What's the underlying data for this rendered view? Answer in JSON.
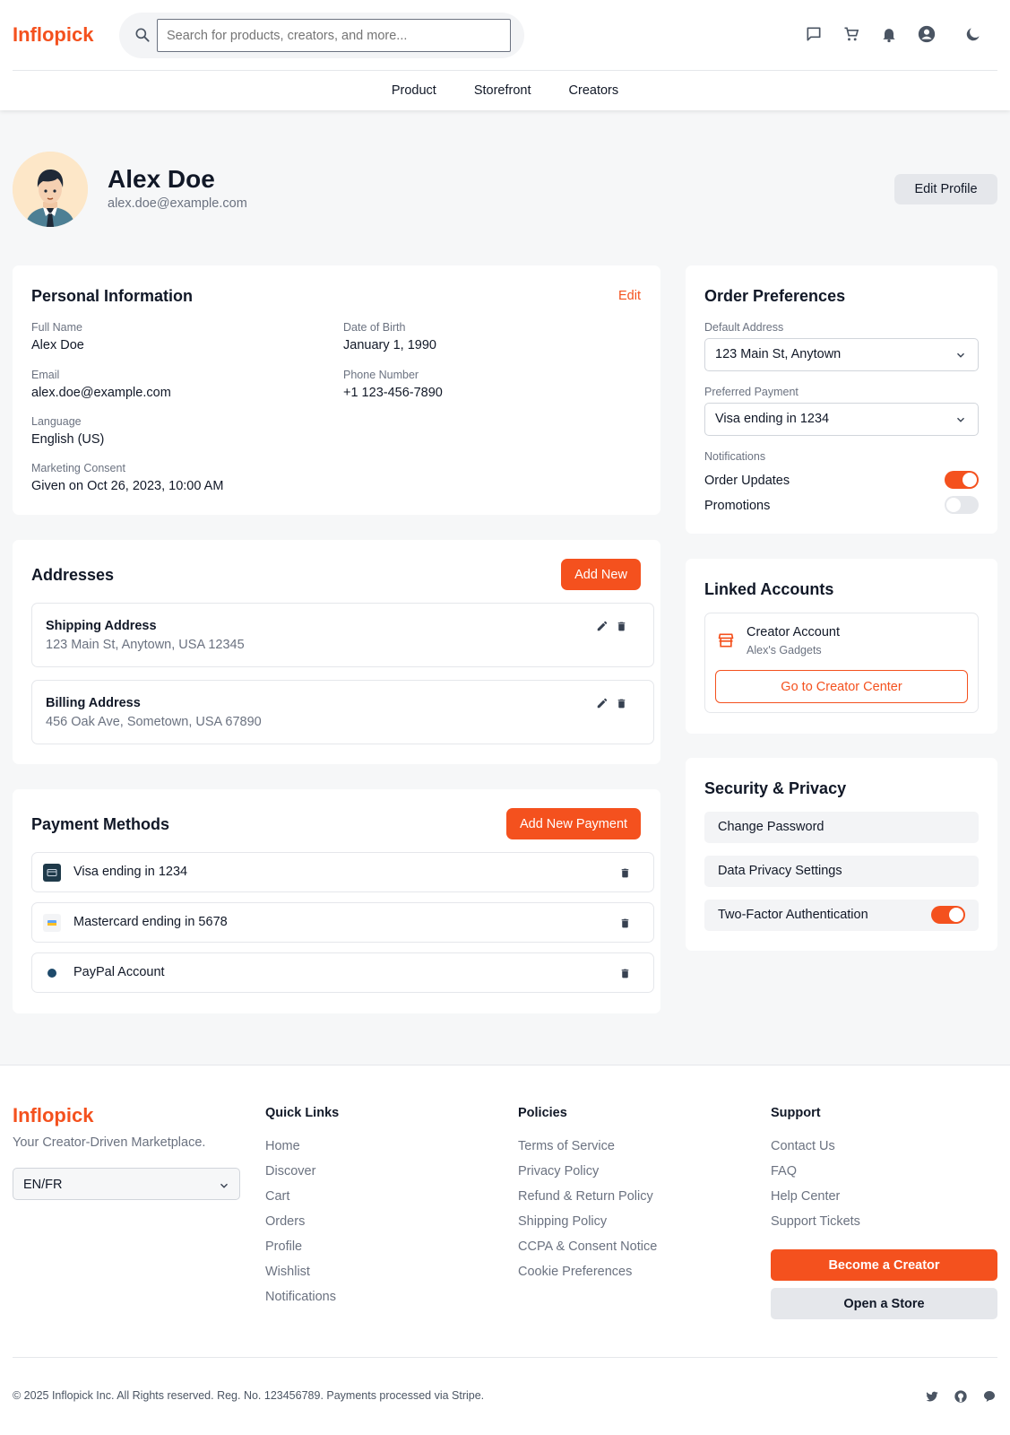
{
  "app": {
    "logo": "Inflopick"
  },
  "search": {
    "placeholder": "Search for products, creators, and more..."
  },
  "nav": {
    "items": [
      "Product",
      "Storefront",
      "Creators"
    ]
  },
  "profile": {
    "name": "Alex Doe",
    "email": "alex.doe@example.com",
    "edit_label": "Edit Profile"
  },
  "personal": {
    "title": "Personal Information",
    "edit_label": "Edit",
    "fields": {
      "full_name": {
        "label": "Full Name",
        "value": "Alex Doe"
      },
      "dob": {
        "label": "Date of Birth",
        "value": "January 1, 1990"
      },
      "email": {
        "label": "Email",
        "value": "alex.doe@example.com"
      },
      "phone": {
        "label": "Phone Number",
        "value": "+1 123-456-7890"
      },
      "language": {
        "label": "Language",
        "value": "English (US)"
      },
      "consent": {
        "label": "Marketing Consent",
        "value": "Given on Oct 26, 2023, 10:00 AM"
      }
    }
  },
  "addresses": {
    "title": "Addresses",
    "add_label": "Add New",
    "items": [
      {
        "title": "Shipping Address",
        "text": "123 Main St, Anytown, USA 12345"
      },
      {
        "title": "Billing Address",
        "text": "456 Oak Ave, Sometown, USA 67890"
      }
    ]
  },
  "payments": {
    "title": "Payment Methods",
    "add_label": "Add New Payment",
    "items": [
      {
        "label": "Visa ending in 1234",
        "icon": "card-icon"
      },
      {
        "label": "Mastercard ending in 5678",
        "icon": "card-icon"
      },
      {
        "label": "PayPal Account",
        "icon": "paypal-icon"
      }
    ]
  },
  "order_prefs": {
    "title": "Order Preferences",
    "default_address_label": "Default Address",
    "default_address_value": "123 Main St, Anytown",
    "payment_label": "Preferred Payment",
    "payment_value": "Visa ending in 1234",
    "notifications_label": "Notifications",
    "toggles": [
      {
        "label": "Order Updates",
        "on": true
      },
      {
        "label": "Promotions",
        "on": false
      }
    ]
  },
  "linked": {
    "title": "Linked Accounts",
    "account_title": "Creator Account",
    "account_sub": "Alex's Gadgets",
    "button_label": "Go to Creator Center"
  },
  "security": {
    "title": "Security & Privacy",
    "items": [
      "Change Password",
      "Data Privacy Settings",
      "Two-Factor Authentication"
    ],
    "two_factor_on": true
  },
  "footer": {
    "logo": "Inflopick",
    "tagline": "Your Creator-Driven Marketplace.",
    "lang_value": "EN/FR",
    "quick_links": {
      "title": "Quick Links",
      "items": [
        "Home",
        "Discover",
        "Cart",
        "Orders",
        "Profile",
        "Wishlist",
        "Notifications"
      ]
    },
    "policies": {
      "title": "Policies",
      "items": [
        "Terms of Service",
        "Privacy Policy",
        "Refund & Return Policy",
        "Shipping Policy",
        "CCPA & Consent Notice",
        "Cookie Preferences"
      ]
    },
    "support": {
      "title": "Support",
      "items": [
        "Contact Us",
        "FAQ",
        "Help Center",
        "Support Tickets"
      ]
    },
    "become_creator": "Become a Creator",
    "open_store": "Open a Store",
    "copyright": "© 2025 Inflopick Inc. All Rights reserved. Reg. No. 123456789. Payments processed via Stripe."
  },
  "colors": {
    "accent": "#f4511e",
    "muted": "#6b7280",
    "bg": "#f6f7f8"
  }
}
